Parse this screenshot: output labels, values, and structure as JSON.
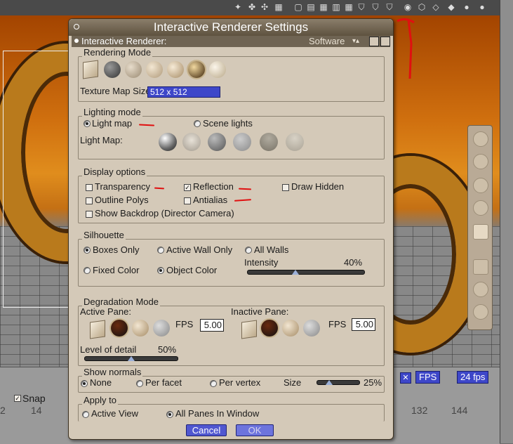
{
  "dialog": {
    "title": "Interactive Renderer Settings",
    "renderer_label": "Interactive Renderer:",
    "renderer_value": "Software"
  },
  "rendering_mode": {
    "group_label": "Rendering Mode",
    "texture_map_label": "Texture Map Size",
    "texture_map_value": "512 x 512"
  },
  "lighting_mode": {
    "group_label": "Lighting mode",
    "light_map": "Light map",
    "scene_lights": "Scene lights",
    "light_map_label": "Light Map:"
  },
  "display_options": {
    "group_label": "Display options",
    "transparency": "Transparency",
    "reflection": "Reflection",
    "draw_hidden": "Draw Hidden",
    "outline_polys": "Outline Polys",
    "antialias": "Antialias",
    "show_backdrop": "Show Backdrop (Director Camera)"
  },
  "silhouette": {
    "group_label": "Silhouette",
    "boxes_only": "Boxes Only",
    "active_wall_only": "Active Wall Only",
    "all_walls": "All Walls",
    "fixed_color": "Fixed Color",
    "object_color": "Object Color",
    "intensity_label": "Intensity",
    "intensity_value": "40%"
  },
  "degradation": {
    "group_label": "Degradation Mode",
    "active_pane": "Active Pane:",
    "inactive_pane": "Inactive Pane:",
    "fps_label": "FPS",
    "active_fps": "5.00",
    "inactive_fps": "5.00",
    "lod_label": "Level of detail",
    "lod_value": "50%"
  },
  "show_normals": {
    "group_label": "Show normals",
    "none": "None",
    "per_facet": "Per facet",
    "per_vertex": "Per vertex",
    "size_label": "Size",
    "size_value": "25%"
  },
  "apply_to": {
    "group_label": "Apply to",
    "active_view": "Active View",
    "all_panes": "All Panes In Window"
  },
  "buttons": {
    "cancel": "Cancel",
    "ok": "OK"
  },
  "background": {
    "snap_label": "Snap",
    "fps_button": "FPS",
    "fps_rate": "24 fps",
    "ruler": [
      "2",
      "14",
      "132",
      "144"
    ]
  },
  "colors": {
    "accent_blue": "#3e47c9",
    "dialog_bg": "#d4c9b8",
    "annotation_red": "#e01010"
  }
}
